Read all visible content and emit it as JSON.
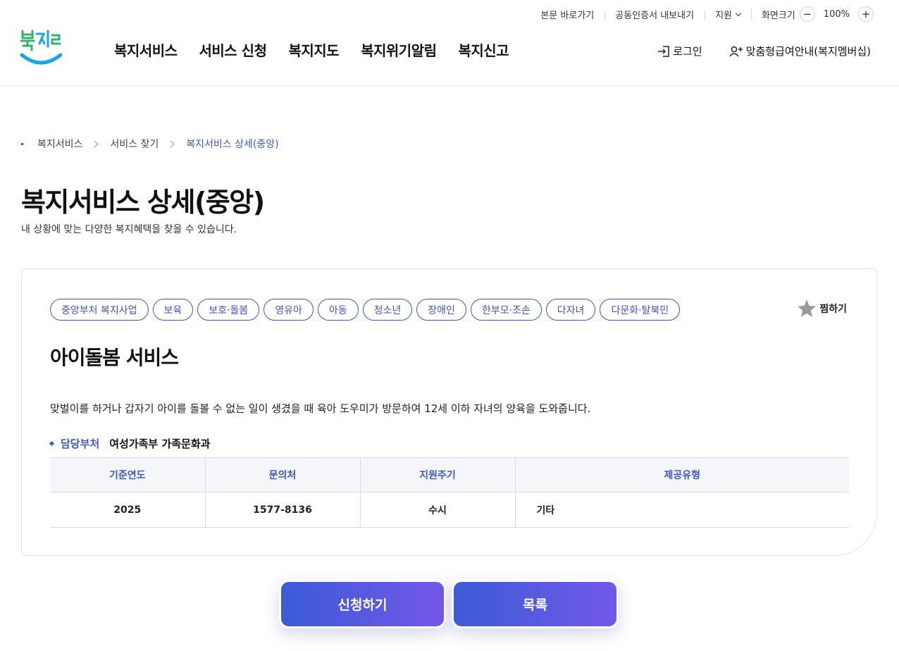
{
  "utility": {
    "skip_link": "본문 바로가기",
    "cert_export": "공동인증서 내보내기",
    "support": "지원",
    "screen_size": "화면크기",
    "zoom_minus": "−",
    "zoom_value": "100%",
    "zoom_plus": "+"
  },
  "header": {
    "logo_text": "복지로",
    "nav": [
      "복지서비스",
      "서비스 신청",
      "복지지도",
      "복지위기알림",
      "복지신고"
    ],
    "login": "로그인",
    "member": "맞춤형급여안내(복지멤버십)"
  },
  "breadcrumb": [
    "복지서비스",
    "서비스 찾기",
    "복지서비스 상세(중앙)"
  ],
  "page": {
    "title": "복지서비스 상세(중앙)",
    "description": "내 상황에 맞는 다양한 복지혜택을 찾을 수 있습니다."
  },
  "service": {
    "tags": [
      "중앙부처 복지사업",
      "보육",
      "보호·돌봄",
      "영유아",
      "아동",
      "청소년",
      "장애인",
      "한부모·조손",
      "다자녀",
      "다문화·탈북민"
    ],
    "favorite_label": "찜하기",
    "title": "아이돌봄 서비스",
    "description": "맞벌이를 하거나 갑자기 아이를 돌볼 수 없는 일이 생겼을 때 육아 도우미가 방문하여 12세 이하 자녀의 양육을 도와줍니다.",
    "dept_label": "담당부처",
    "dept_value": "여성가족부 가족문화과",
    "table": {
      "headers": [
        "기준연도",
        "문의처",
        "지원주기",
        "제공유형"
      ],
      "row": [
        "2025",
        "1577-8136",
        "수시",
        "기타"
      ]
    }
  },
  "actions": {
    "apply": "신청하기",
    "list": "목록"
  },
  "colors": {
    "accent": "#3d56c9",
    "button_gradient_start": "#3b5bd8",
    "button_gradient_end": "#7358e8",
    "logo_green": "#2fb36f",
    "logo_blue": "#1aa5e6"
  }
}
